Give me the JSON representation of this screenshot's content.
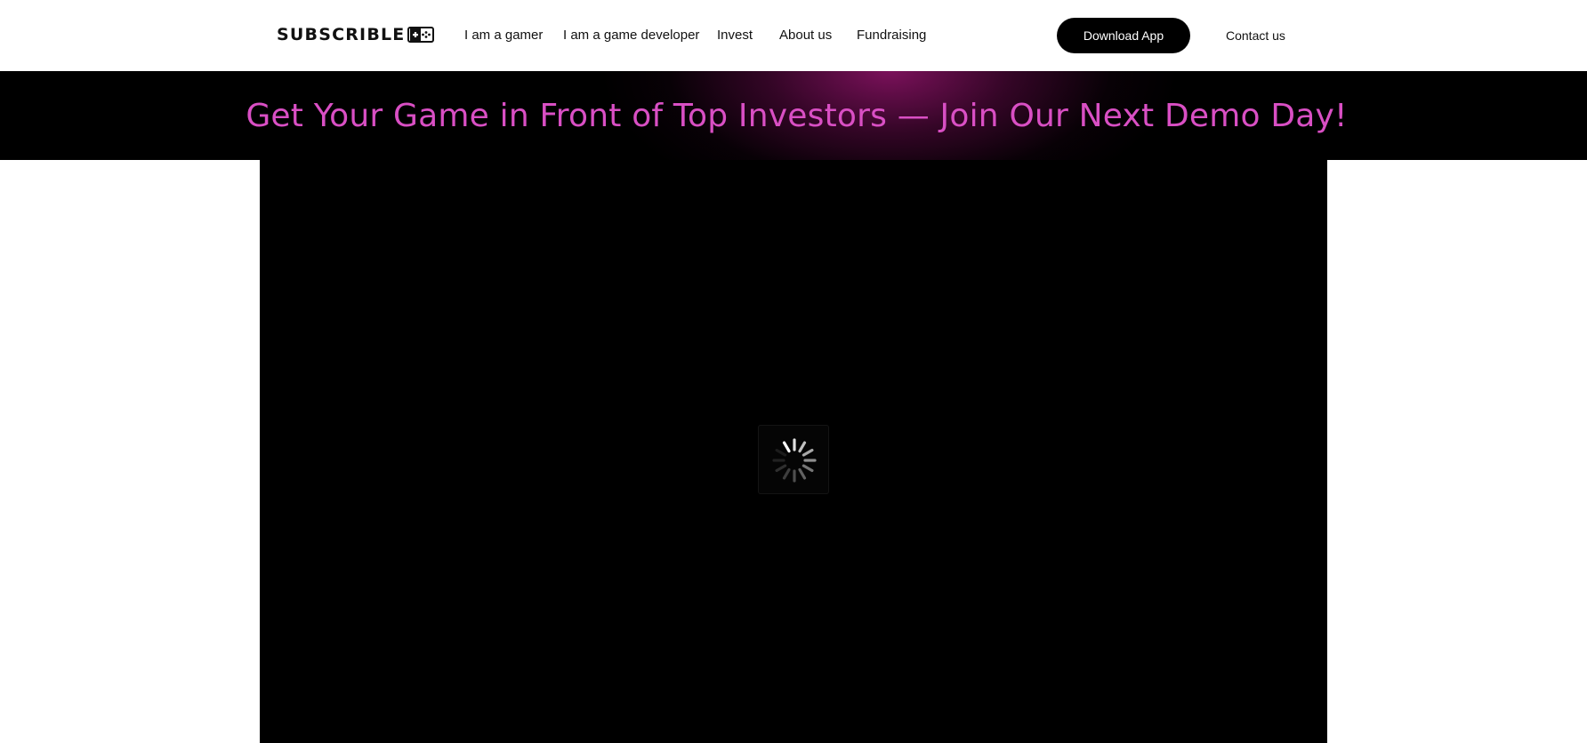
{
  "header": {
    "logo": {
      "text": "SUBSCRIBLE",
      "icon": "gamepad-plus-icon"
    },
    "nav": [
      {
        "label": "I am a gamer"
      },
      {
        "label": "I am a game developer"
      },
      {
        "label": "Invest"
      },
      {
        "label": "About us"
      },
      {
        "label": "Fundraising"
      }
    ],
    "download_label": "Download App",
    "contact_label": "Contact us"
  },
  "banner": {
    "text": "Get Your Game in Front of Top Investors — Join Our Next Demo Day!",
    "text_color": "#d94fc4",
    "background": "#000000",
    "glow_color": "#820f60"
  },
  "video": {
    "state_icon": "loading-spinner-icon",
    "background": "#000000"
  }
}
